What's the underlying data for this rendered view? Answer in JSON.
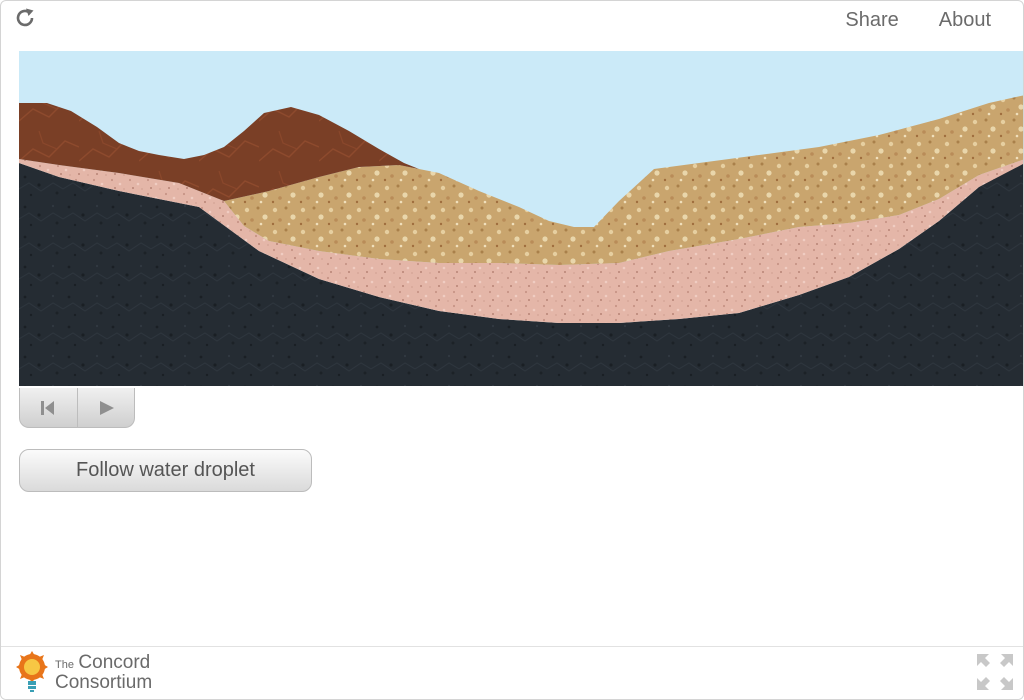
{
  "app": {
    "reload_icon": "reload-icon"
  },
  "nav": {
    "share": "Share",
    "about": "About"
  },
  "simulation": {
    "sky_color": "#cbeaf8",
    "layers": [
      {
        "name": "bedrock",
        "color": "#252c33"
      },
      {
        "name": "clay",
        "color": "#e4b6a8"
      },
      {
        "name": "sand",
        "color": "#c9a56e"
      },
      {
        "name": "topsoil",
        "color": "#7a3f26"
      }
    ]
  },
  "playback": {
    "reset_icon": "reset-icon",
    "play_icon": "play-icon"
  },
  "buttons": {
    "follow_droplet": "Follow water droplet"
  },
  "footer": {
    "logo_the": "The",
    "logo_concord": "Concord",
    "logo_consortium": "Consortium",
    "fullscreen_icon": "fullscreen-icon"
  }
}
